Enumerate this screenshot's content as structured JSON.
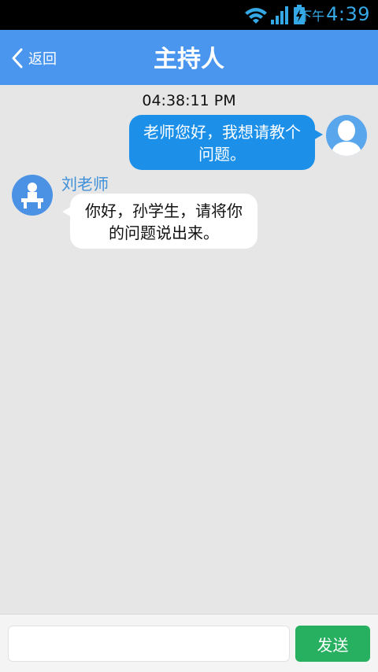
{
  "status_bar": {
    "ampm": "下午",
    "time": "4:39",
    "icons": [
      "wifi-icon",
      "signal-icon",
      "battery-charging-icon"
    ],
    "accent_color": "#35a8e6"
  },
  "header": {
    "back_label": "返回",
    "title": "主持人",
    "background_color": "#4a96ef"
  },
  "chat": {
    "timestamp": "04:38:11 PM",
    "messages": [
      {
        "direction": "outgoing",
        "lines": [
          "老师您好，我想请教个",
          "问题。"
        ],
        "bubble_color": "#1c90e9",
        "avatar": "user-avatar-icon"
      },
      {
        "direction": "incoming",
        "sender": "刘老师",
        "lines": [
          "你好，孙学生，请将你",
          "的问题说出来。"
        ],
        "bubble_color": "#ffffff",
        "avatar": "teacher-avatar-icon"
      }
    ]
  },
  "composer": {
    "input_value": "",
    "placeholder": "",
    "send_label": "发送",
    "send_color": "#26b060"
  }
}
